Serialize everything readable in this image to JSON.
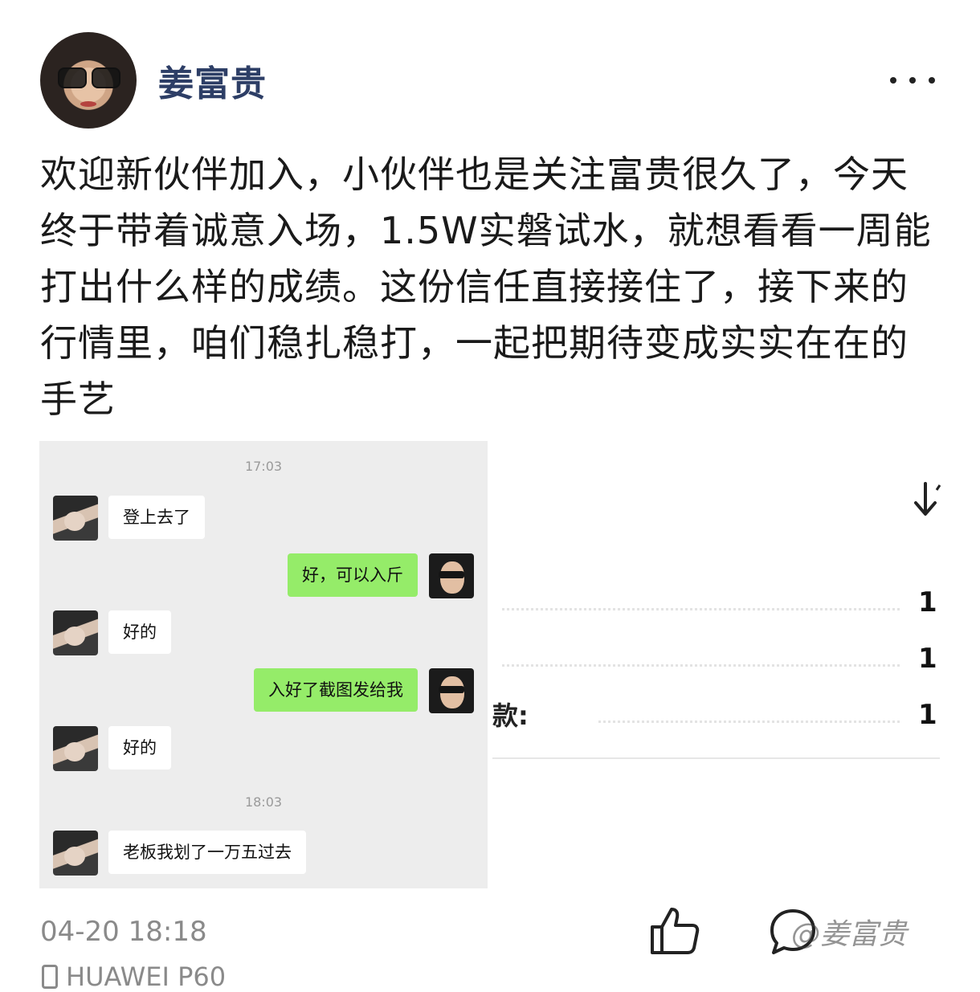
{
  "header": {
    "username": "姜富贵",
    "more_icon": "more-dots-icon"
  },
  "post": {
    "text": "欢迎新伙伴加入，小伙伴也是关注富贵很久了，今天终于带着诚意入场，1.5W实磐试水，就想看看一周能打出什么样的成绩。这份信任直接接住了，接下来的行情里，咱们稳扎稳打，一起把期待变成实实在在的手艺"
  },
  "chat": {
    "time1": "17:03",
    "time2": "18:03",
    "messages": [
      {
        "side": "left",
        "text": "登上去了"
      },
      {
        "side": "right",
        "text": "好，可以入斤"
      },
      {
        "side": "left",
        "text": "好的"
      },
      {
        "side": "right",
        "text": "入好了截图发给我"
      },
      {
        "side": "left",
        "text": "好的"
      },
      {
        "side": "left",
        "text": "老板我划了一万五过去"
      }
    ]
  },
  "partial": {
    "rows": [
      "1",
      "1",
      "1"
    ],
    "label": "款:"
  },
  "footer": {
    "timestamp": "04-20 18:18",
    "device": "HUAWEI P60",
    "watermark": "@姜富贵"
  },
  "colors": {
    "username": "#2d3e66",
    "bubble_right": "#95ec69",
    "chat_bg": "#ededed"
  }
}
